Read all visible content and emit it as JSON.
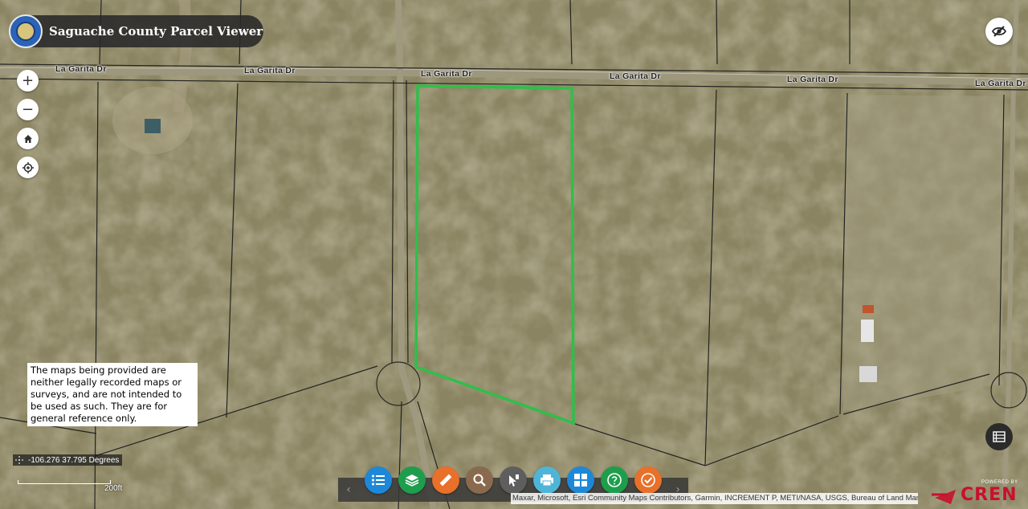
{
  "app": {
    "title": "Saguache County Parcel Viewer"
  },
  "roads": [
    {
      "label": "La Garita Dr"
    },
    {
      "label": "La Garita Dr"
    },
    {
      "label": "La Garita Dr"
    },
    {
      "label": "La Garita Dr"
    },
    {
      "label": "La Garita Dr"
    },
    {
      "label": "La Garita Dr"
    }
  ],
  "controls": {
    "zoom_in": "+",
    "zoom_out": "−",
    "home_icon": "home-icon",
    "locate_icon": "locate-icon",
    "hide_icon": "eye-off-icon"
  },
  "disclaimer": "The maps being provided are neither legally recorded maps or surveys, and are not intended to be used as such. They are for general reference only.",
  "coordinates": "-106.276 37.795 Degrees",
  "scale": "200ft",
  "toolbar": {
    "prev": "‹",
    "next": "›",
    "tools": [
      {
        "name": "layer-list-icon",
        "color": "#1e88d8"
      },
      {
        "name": "layers-icon",
        "color": "#1e9e4c"
      },
      {
        "name": "measure-icon",
        "color": "#e8702a"
      },
      {
        "name": "search-icon",
        "color": "#8a6a4e"
      },
      {
        "name": "identify-icon",
        "color": "#5e5e5e"
      },
      {
        "name": "print-icon",
        "color": "#4fb5d8"
      },
      {
        "name": "basemap-gallery-icon",
        "color": "#1e88d8"
      },
      {
        "name": "help-icon",
        "color": "#1e9e4c"
      },
      {
        "name": "check-icon",
        "color": "#e8702a"
      }
    ]
  },
  "attribution": "Maxar, Microsoft, Esri Community Maps Contributors, Garmin, INCREMENT P, METI/NASA, USGS, Bureau of Land Management",
  "branding": {
    "powered_by": "POWERED BY",
    "name": "CREN"
  },
  "parcel_color": "#2fbf4a"
}
